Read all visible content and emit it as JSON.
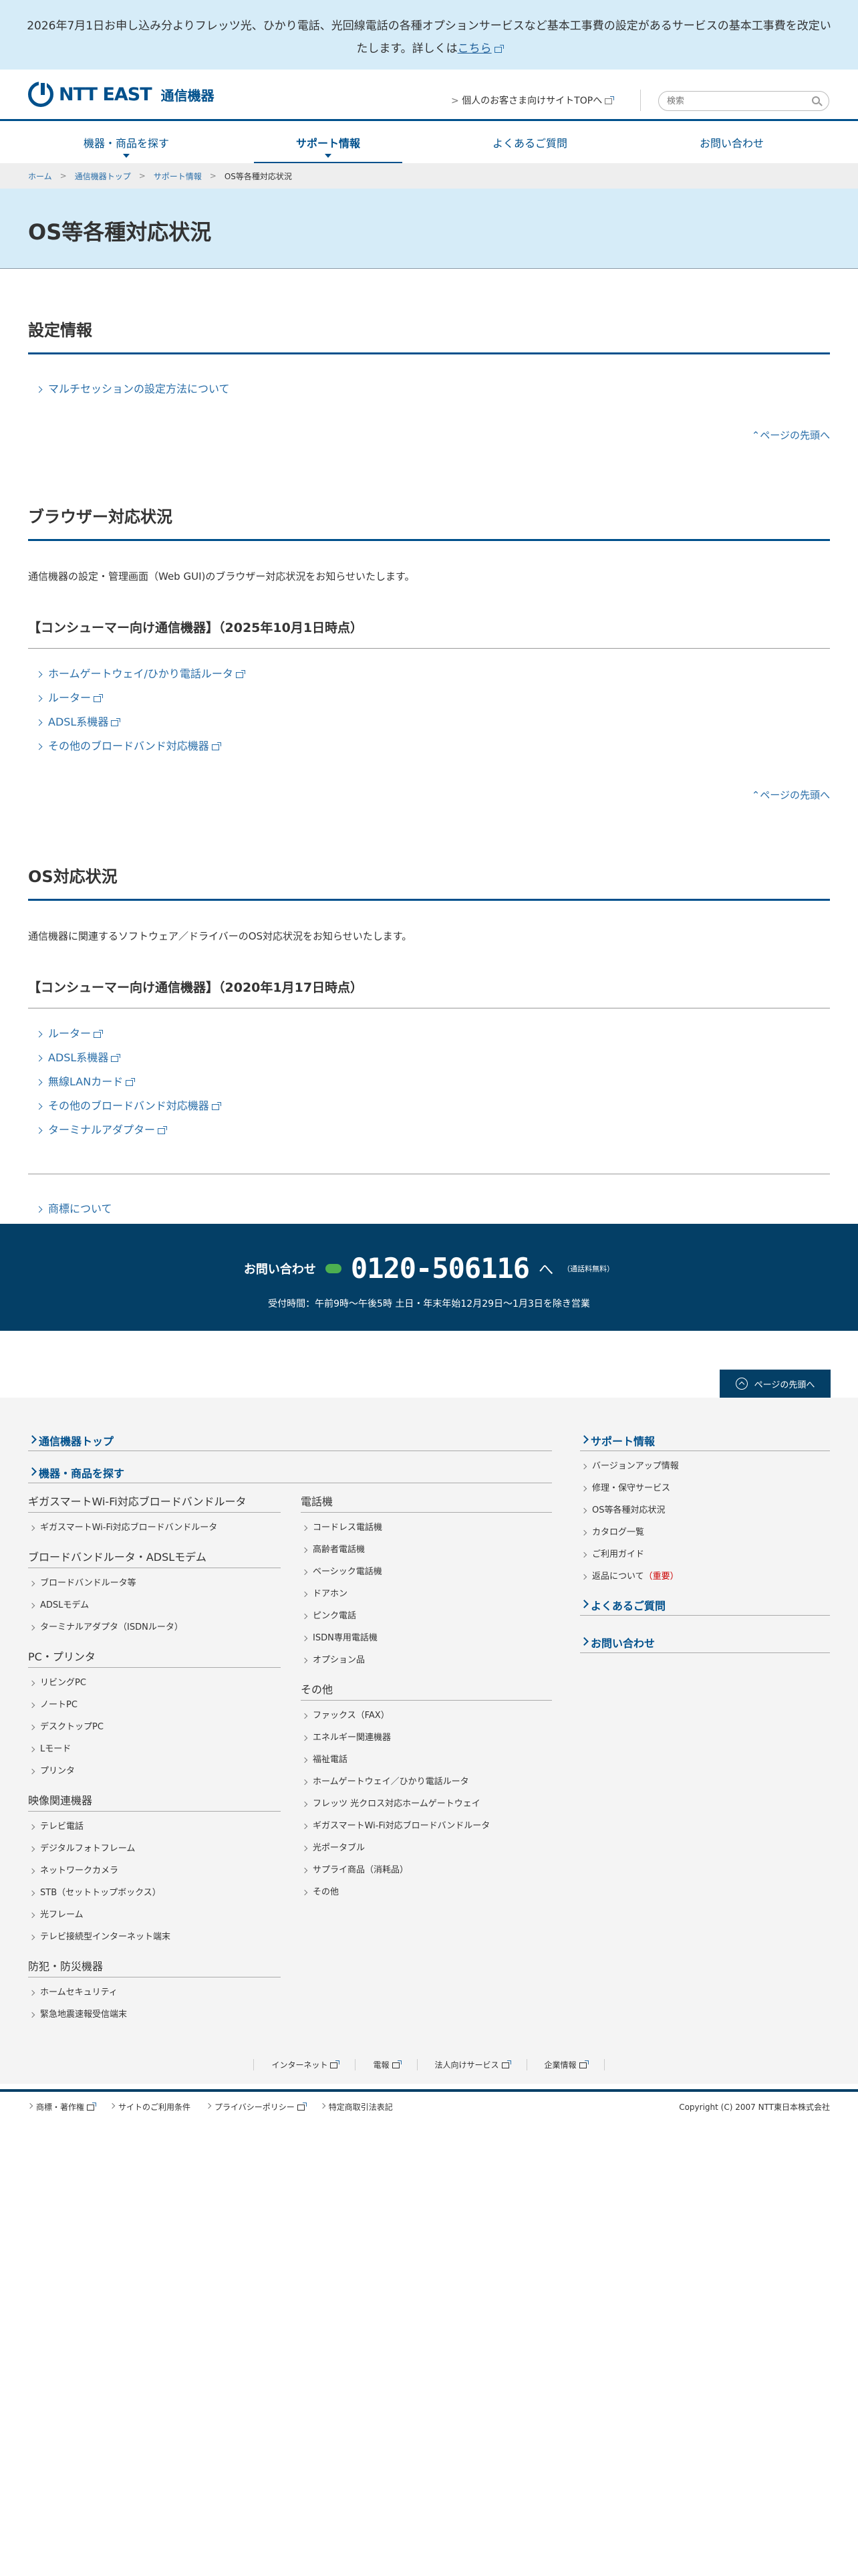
{
  "notice": {
    "text": "2026年7月1日お申し込み分よりフレッツ光、ひかり電話、光回線電話の各種オプションサービスなど基本工事費の設定があるサービスの基本工事費を改定いたします。詳しくは",
    "link": "こちら"
  },
  "header": {
    "brand": "NTT EAST",
    "sub": "通信機器",
    "toplink": "個人のお客さま向けサイトTOPへ",
    "search_placeholder": "検索"
  },
  "gnav": [
    {
      "label": "機器・商品を探す"
    },
    {
      "label": "サポート情報"
    },
    {
      "label": "よくあるご質問"
    },
    {
      "label": "お問い合わせ"
    }
  ],
  "breadcrumb": [
    "ホーム",
    "通信機器トップ",
    "サポート情報",
    "OS等各種対応状況"
  ],
  "page_title": "OS等各種対応状況",
  "pagetop_label": "ページの先頭へ",
  "sections": {
    "settings": {
      "title": "設定情報",
      "links": [
        "マルチセッションの設定方法について"
      ]
    },
    "browser": {
      "title": "ブラウザー対応状況",
      "desc": "通信機器の設定・管理画面（Web GUI)のブラウザー対応状況をお知らせいたします。",
      "subtitle": "【コンシューマー向け通信機器】（2025年10月1日時点）",
      "links": [
        "ホームゲートウェイ/ひかり電話ルータ",
        "ルーター",
        "ADSL系機器",
        "その他のブロードバンド対応機器"
      ]
    },
    "os": {
      "title": "OS対応状況",
      "desc": "通信機器に関連するソフトウェア／ドライバーのOS対応状況をお知らせいたします。",
      "subtitle": "【コンシューマー向け通信機器】（2020年1月17日時点）",
      "links": [
        "ルーター",
        "ADSL系機器",
        "無線LANカード",
        "その他のブロードバンド対応機器",
        "ターミナルアダプター"
      ]
    },
    "trademark": "商標について"
  },
  "contact": {
    "label": "お問い合わせ",
    "tel": "0120-506116",
    "tel_suffix": "へ",
    "note": "（通話料無料）",
    "hours": "受付時間：午前9時〜午後5時 土日・年末年始12月29日〜1月3日を除き営業"
  },
  "pagetop_button": "ページの先頭へ",
  "sitemap": {
    "top": "通信機器トップ",
    "products": "機器・商品を探す",
    "col1": [
      {
        "cat": "ギガスマートWi-Fi対応ブロードバンドルータ",
        "items": [
          "ギガスマートWi-Fi対応ブロードバンドルータ"
        ]
      },
      {
        "cat": "ブロードバンドルータ・ADSLモデム",
        "items": [
          "ブロードバンドルータ等",
          "ADSLモデム",
          "ターミナルアダプタ（ISDNルータ）"
        ]
      },
      {
        "cat": "PC・プリンタ",
        "items": [
          "リビングPC",
          "ノートPC",
          "デスクトップPC",
          "Lモード",
          "プリンタ"
        ]
      },
      {
        "cat": "映像関連機器",
        "items": [
          "テレビ電話",
          "デジタルフォトフレーム",
          "ネットワークカメラ",
          "STB（セットトップボックス）",
          "光フレーム",
          "テレビ接続型インターネット端末"
        ]
      },
      {
        "cat": "防犯・防災機器",
        "items": [
          "ホームセキュリティ",
          "緊急地震速報受信端末"
        ]
      }
    ],
    "col2": [
      {
        "cat": "電話機",
        "items": [
          "コードレス電話機",
          "高齢者電話機",
          "ベーシック電話機",
          "ドアホン",
          "ピンク電話",
          "ISDN専用電話機",
          "オプション品"
        ]
      },
      {
        "cat": "その他",
        "items": [
          "ファックス（FAX）",
          "エネルギー関連機器",
          "福祉電話",
          "ホームゲートウェイ／ひかり電話ルータ",
          "フレッツ 光クロス対応ホームゲートウェイ",
          "ギガスマートWi-Fi対応ブロードバンドルータ",
          "光ポータブル",
          "サプライ商品（消耗品）",
          "その他"
        ]
      }
    ],
    "col3": {
      "support": "サポート情報",
      "support_items": [
        "バージョンアップ情報",
        "修理・保守サービス",
        "OS等各種対応状況",
        "カタログ一覧",
        "ご利用ガイド"
      ],
      "return_item": "返品について",
      "return_badge": "（重要）",
      "faq": "よくあるご質問",
      "contact": "お問い合わせ"
    }
  },
  "footer_nav": [
    "インターネット",
    "電報",
    "法人向けサービス",
    "企業情報"
  ],
  "footer_bar": [
    "商標・著作権",
    "サイトのご利用条件",
    "プライバシーポリシー",
    "特定商取引法表記"
  ],
  "copyright": "Copyright (C) 2007 NTT東日本株式会社"
}
